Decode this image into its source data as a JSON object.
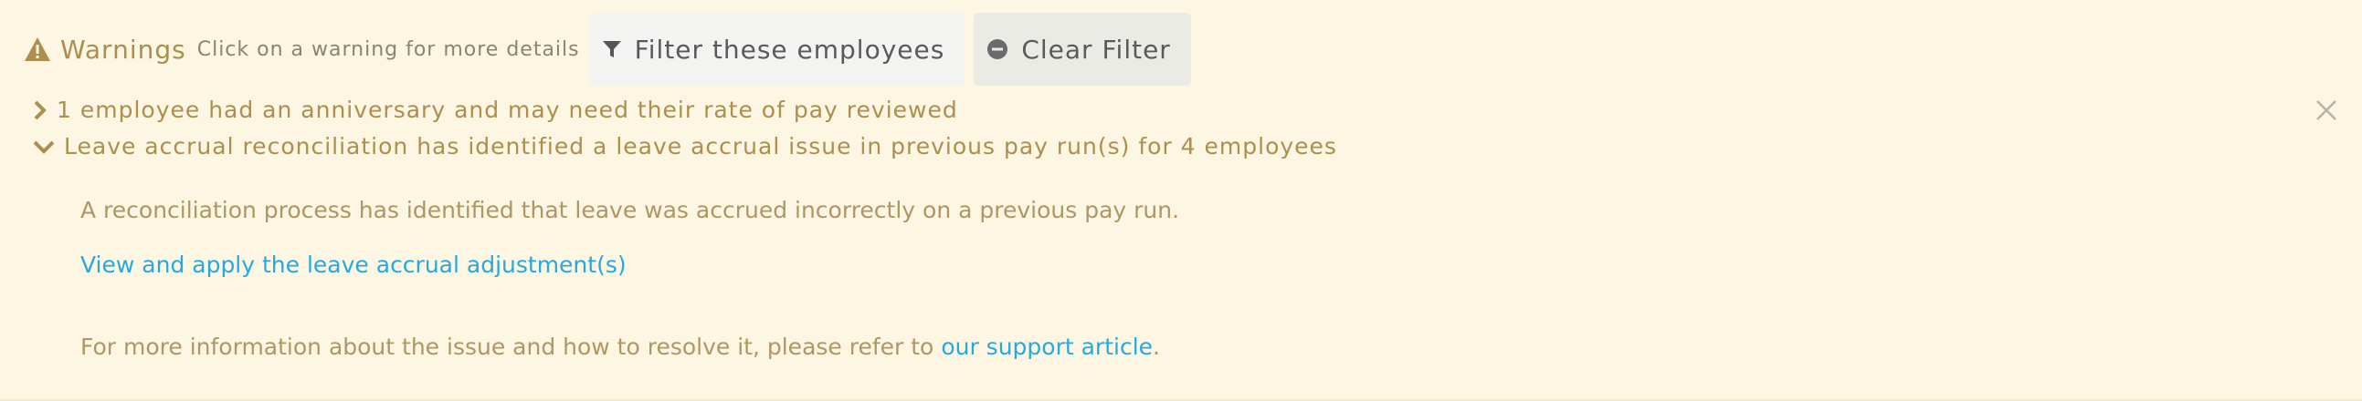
{
  "warnings": {
    "title": "Warnings",
    "hint": "Click on a warning for more details",
    "filter_button": "Filter these employees",
    "clear_button": "Clear Filter",
    "items": [
      {
        "label": "1 employee had an anniversary and may need their rate of pay reviewed",
        "expanded": false
      },
      {
        "label": "Leave accrual reconciliation has identified a leave accrual issue in previous pay run(s) for 4 employees",
        "expanded": true
      }
    ],
    "detail": {
      "description": "A reconciliation process has identified that leave was accrued incorrectly on a previous pay run.",
      "action_link": "View and apply the leave accrual adjustment(s)",
      "more_info_prefix": "For more information about the issue and how to resolve it, please refer to ",
      "more_info_link": "our support article",
      "more_info_suffix": "."
    }
  },
  "colors": {
    "background": "#fcf6e3",
    "warning_text": "#ad8e4d",
    "link": "#29a8dd"
  },
  "icons": {
    "title": "warning-triangle-icon",
    "filter": "funnel-icon",
    "clear": "minus-circle-icon",
    "collapsed": "chevron-right-icon",
    "expanded": "chevron-down-icon",
    "dismiss": "close-icon"
  }
}
